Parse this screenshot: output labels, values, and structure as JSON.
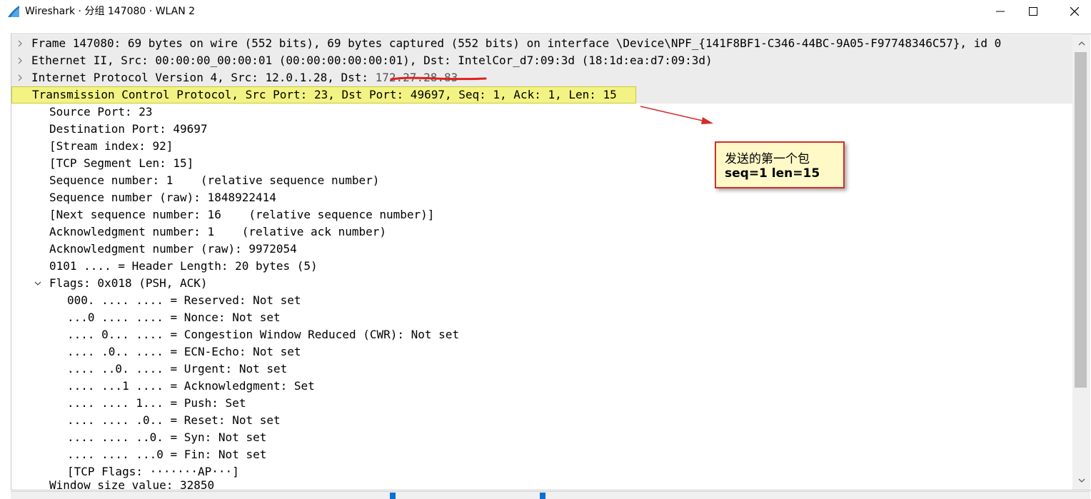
{
  "window": {
    "title": "Wireshark · 分组 147080 · WLAN 2"
  },
  "tree": {
    "frame": "Frame 147080: 69 bytes on wire (552 bits), 69 bytes captured (552 bits) on interface \\Device\\NPF_{141F8BF1-C346-44BC-9A05-F97748346C57}, id 0",
    "ethernet": "Ethernet II, Src: 00:00:00_00:00:01 (00:00:00:00:00:01), Dst: IntelCor_d7:09:3d (18:1d:ea:d7:09:3d)",
    "ip": "Internet Protocol Version 4, Src: 12.0.1.28, Dst: ",
    "ip_redacted": "172.27.28.83",
    "tcp": "Transmission Control Protocol, Src Port: 23, Dst Port: 49697, Seq: 1, Ack: 1, Len: 15",
    "tcp_fields": [
      "Source Port: 23",
      "Destination Port: 49697",
      "[Stream index: 92]",
      "[TCP Segment Len: 15]",
      "Sequence number: 1    (relative sequence number)",
      "Sequence number (raw): 1848922414",
      "[Next sequence number: 16    (relative sequence number)]",
      "Acknowledgment number: 1    (relative ack number)",
      "Acknowledgment number (raw): 9972054",
      "0101 .... = Header Length: 20 bytes (5)"
    ],
    "flags": "Flags: 0x018 (PSH, ACK)",
    "flag_fields": [
      "000. .... .... = Reserved: Not set",
      "...0 .... .... = Nonce: Not set",
      ".... 0... .... = Congestion Window Reduced (CWR): Not set",
      ".... .0.. .... = ECN-Echo: Not set",
      ".... ..0. .... = Urgent: Not set",
      ".... ...1 .... = Acknowledgment: Set",
      ".... .... 1... = Push: Set",
      ".... .... .0.. = Reset: Not set",
      ".... .... ..0. = Syn: Not set",
      ".... .... ...0 = Fin: Not set",
      "[TCP Flags: ·······AP···]"
    ],
    "cut_row": "Window size value: 32850"
  },
  "annotation": {
    "line1": "发送的第一个包",
    "line2": "seq=1 len=15"
  },
  "colors": {
    "selected_bg": "#f3f383",
    "annotation_border": "#d42c2c",
    "annotation_bg": "#fff9c8",
    "accent": "#0b6fd4"
  },
  "icons": [
    "wireshark-fin-icon",
    "minimize-icon",
    "maximize-icon",
    "close-icon",
    "chevron-right-icon",
    "chevron-down-icon",
    "scroll-up-icon",
    "scroll-down-icon"
  ]
}
